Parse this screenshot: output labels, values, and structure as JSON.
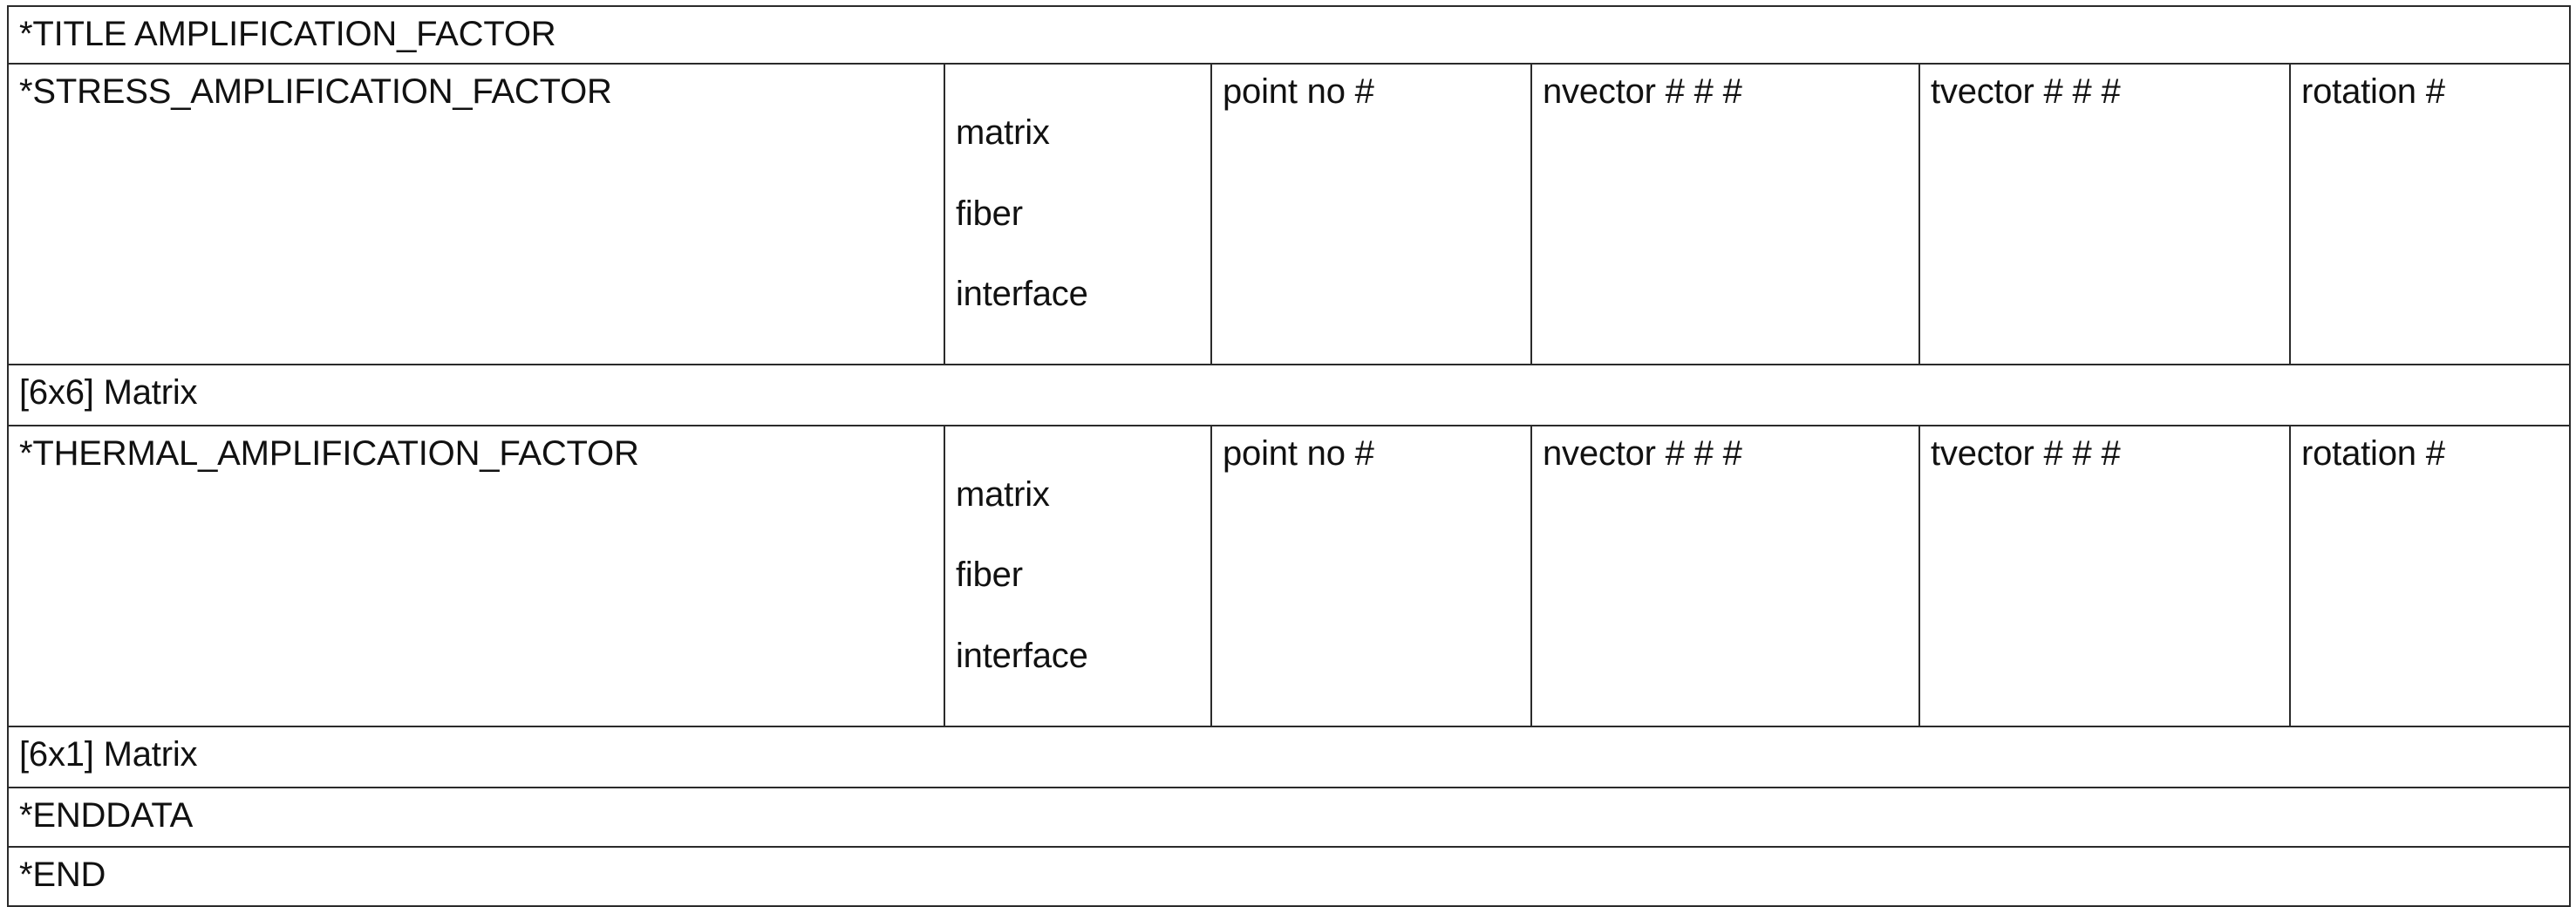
{
  "document": {
    "kind": "keyword-input-deck-specification-table",
    "border_color": "#2b2b2b",
    "text_color": "#111111",
    "background_color": "#ffffff"
  },
  "columns": [
    {
      "key": "directive",
      "label": ""
    },
    {
      "key": "phase",
      "label": ""
    },
    {
      "key": "point",
      "label": ""
    },
    {
      "key": "nvector",
      "label": ""
    },
    {
      "key": "tvector",
      "label": ""
    },
    {
      "key": "rotation",
      "label": ""
    }
  ],
  "rows": {
    "title": {
      "directive": "*TITLE AMPLIFICATION_FACTOR"
    },
    "stress": {
      "directive": "*STRESS_AMPLIFICATION_FACTOR",
      "phase_line_1": "matrix",
      "phase_line_2": "fiber",
      "phase_line_3": "interface",
      "point": "point no #",
      "nvector": "nvector # # #",
      "tvector": "tvector # # #",
      "rotation": "rotation #"
    },
    "stress_matrix": {
      "directive": "[6x6] Matrix"
    },
    "thermal": {
      "directive": "*THERMAL_AMPLIFICATION_FACTOR",
      "phase_line_1": "matrix",
      "phase_line_2": "fiber",
      "phase_line_3": "interface",
      "point": "point no #",
      "nvector": "nvector # # #",
      "tvector": "tvector # # #",
      "rotation": "rotation #"
    },
    "thermal_matrix": {
      "directive": "[6x1] Matrix"
    },
    "enddata": {
      "directive": "*ENDDATA"
    },
    "end": {
      "directive": "*END"
    }
  }
}
